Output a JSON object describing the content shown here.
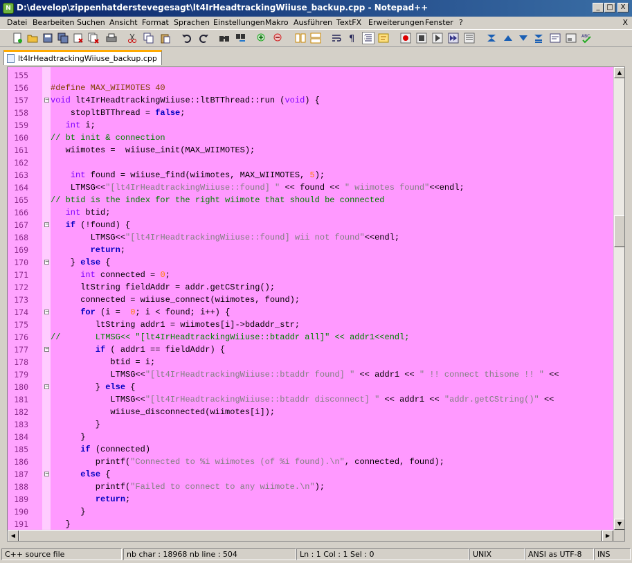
{
  "window": {
    "title": "D:\\develop\\zippenhatderstevegesagt\\lt4IrHeadtrackingWiiuse_backup.cpp - Notepad++",
    "app_icon": "notepad-plus-plus-icon",
    "minimize": "_",
    "maximize": "□",
    "close": "X"
  },
  "menu": {
    "items": [
      "Datei",
      "Bearbeiten",
      "Suchen",
      "Ansicht",
      "Format",
      "Sprachen",
      "Einstellungen",
      "Makro",
      "Ausführen",
      "TextFX",
      "Erweiterungen",
      "Fenster",
      "?"
    ],
    "close_doc": "X"
  },
  "toolbar": {
    "icons": [
      "new-file-icon",
      "open-file-icon",
      "save-icon",
      "save-all-icon",
      "close-icon",
      "close-all-icon",
      "print-icon",
      "cut-icon",
      "copy-icon",
      "paste-icon",
      "undo-icon",
      "redo-icon",
      "find-icon",
      "replace-icon",
      "zoom-in-icon",
      "zoom-out-icon",
      "sync-vertical-icon",
      "sync-horizontal-icon",
      "word-wrap-icon",
      "show-all-chars-icon",
      "indent-guide-icon",
      "user-lang-icon",
      "record-macro-icon",
      "stop-macro-icon",
      "play-macro-icon",
      "run-macro-multiple-icon",
      "save-macro-icon",
      "fold-all-icon",
      "previous-icon",
      "next-icon",
      "doc-map-icon",
      "function-list-icon",
      "panel-icon",
      "spellcheck-icon"
    ]
  },
  "tab": {
    "label": "lt4IrHeadtrackingWiiuse_backup.cpp"
  },
  "editor": {
    "lines": [
      {
        "n": "155",
        "fold": "",
        "segs": []
      },
      {
        "n": "156",
        "fold": "",
        "segs": [
          [
            "pp",
            "#define MAX_WIIMOTES 40"
          ]
        ]
      },
      {
        "n": "157",
        "fold": "-",
        "segs": [
          [
            "ty",
            "void"
          ],
          [
            "",
            " lt4IrHeadtrackingWiiuse::ltBTThread::run ("
          ],
          [
            "ty",
            "void"
          ],
          [
            "",
            ") {"
          ]
        ]
      },
      {
        "n": "158",
        "fold": "",
        "segs": [
          [
            "",
            "    stopltBTThread = "
          ],
          [
            "kw",
            "false"
          ],
          [
            "",
            ";"
          ]
        ]
      },
      {
        "n": "159",
        "fold": "",
        "segs": [
          [
            "",
            "   "
          ],
          [
            "ty",
            "int"
          ],
          [
            "",
            " i;"
          ]
        ]
      },
      {
        "n": "160",
        "fold": "",
        "segs": [
          [
            "cm",
            "// bt init & connection"
          ]
        ]
      },
      {
        "n": "161",
        "fold": "",
        "segs": [
          [
            "",
            "   wiimotes =  wiiuse_init(MAX_WIIMOTES);"
          ]
        ]
      },
      {
        "n": "162",
        "fold": "",
        "segs": []
      },
      {
        "n": "163",
        "fold": "",
        "segs": [
          [
            "",
            "    "
          ],
          [
            "ty",
            "int"
          ],
          [
            "",
            " found = wiiuse_find(wiimotes, MAX_WIIMOTES, "
          ],
          [
            "num",
            "5"
          ],
          [
            "",
            ");"
          ]
        ]
      },
      {
        "n": "164",
        "fold": "",
        "segs": [
          [
            "",
            "    LTMSG<<"
          ],
          [
            "str",
            "\"[lt4IrHeadtrackingWiiuse::found] \""
          ],
          [
            "",
            " << found << "
          ],
          [
            "str",
            "\" wiimotes found\""
          ],
          [
            "",
            "<<endl;"
          ]
        ]
      },
      {
        "n": "165",
        "fold": "",
        "segs": [
          [
            "cm",
            "// btid is the index for the right wiimote that should be connected"
          ]
        ]
      },
      {
        "n": "166",
        "fold": "",
        "segs": [
          [
            "",
            "   "
          ],
          [
            "ty",
            "int"
          ],
          [
            "",
            " btid;"
          ]
        ]
      },
      {
        "n": "167",
        "fold": "-",
        "segs": [
          [
            "",
            "   "
          ],
          [
            "kw",
            "if"
          ],
          [
            "",
            " (!found) {"
          ]
        ]
      },
      {
        "n": "168",
        "fold": "",
        "segs": [
          [
            "",
            "        LTMSG<<"
          ],
          [
            "str",
            "\"[lt4IrHeadtrackingWiiuse::found] wii not found\""
          ],
          [
            "",
            "<<endl;"
          ]
        ]
      },
      {
        "n": "169",
        "fold": "",
        "segs": [
          [
            "",
            "        "
          ],
          [
            "kw",
            "return"
          ],
          [
            "",
            ";"
          ]
        ]
      },
      {
        "n": "170",
        "fold": "-",
        "segs": [
          [
            "",
            "    } "
          ],
          [
            "kw",
            "else"
          ],
          [
            "",
            " {"
          ]
        ]
      },
      {
        "n": "171",
        "fold": "",
        "segs": [
          [
            "",
            "      "
          ],
          [
            "ty",
            "int"
          ],
          [
            "",
            " connected = "
          ],
          [
            "num",
            "0"
          ],
          [
            "",
            ";"
          ]
        ]
      },
      {
        "n": "172",
        "fold": "",
        "segs": [
          [
            "",
            "      ltString fieldAddr = addr.getCString();"
          ]
        ]
      },
      {
        "n": "173",
        "fold": "",
        "segs": [
          [
            "",
            "      connected = wiiuse_connect(wiimotes, found);"
          ]
        ]
      },
      {
        "n": "174",
        "fold": "-",
        "segs": [
          [
            "",
            "      "
          ],
          [
            "kw",
            "for"
          ],
          [
            "",
            " (i =  "
          ],
          [
            "num",
            "0"
          ],
          [
            "",
            "; i < found; i++) {"
          ]
        ]
      },
      {
        "n": "175",
        "fold": "",
        "segs": [
          [
            "",
            "         ltString addr1 = wiimotes[i]->bdaddr_str;"
          ]
        ]
      },
      {
        "n": "176",
        "fold": "",
        "segs": [
          [
            "cm",
            "//       LTMSG<< \"[lt4IrHeadtrackingWiiuse::btaddr all]\" << addr1<<endl;"
          ]
        ]
      },
      {
        "n": "177",
        "fold": "-",
        "segs": [
          [
            "",
            "         "
          ],
          [
            "kw",
            "if"
          ],
          [
            "",
            " ( addr1 == fieldAddr) {"
          ]
        ]
      },
      {
        "n": "178",
        "fold": "",
        "segs": [
          [
            "",
            "            btid = i;"
          ]
        ]
      },
      {
        "n": "179",
        "fold": "",
        "segs": [
          [
            "",
            "            LTMSG<<"
          ],
          [
            "str",
            "\"[lt4IrHeadtrackingWiiuse::btaddr found] \""
          ],
          [
            "",
            " << addr1 << "
          ],
          [
            "str",
            "\" !! connect thisone !! \""
          ],
          [
            "",
            " <<"
          ]
        ]
      },
      {
        "n": "180",
        "fold": "-",
        "segs": [
          [
            "",
            "         } "
          ],
          [
            "kw",
            "else"
          ],
          [
            "",
            " {"
          ]
        ]
      },
      {
        "n": "181",
        "fold": "",
        "segs": [
          [
            "",
            "            LTMSG<<"
          ],
          [
            "str",
            "\"[lt4IrHeadtrackingWiiuse::btaddr disconnect] \""
          ],
          [
            "",
            " << addr1 << "
          ],
          [
            "str",
            "\"addr.getCString()\""
          ],
          [
            "",
            " <<"
          ]
        ]
      },
      {
        "n": "182",
        "fold": "",
        "segs": [
          [
            "",
            "            wiiuse_disconnected(wiimotes[i]);"
          ]
        ]
      },
      {
        "n": "183",
        "fold": "",
        "segs": [
          [
            "",
            "         }"
          ]
        ]
      },
      {
        "n": "184",
        "fold": "",
        "segs": [
          [
            "",
            "      }"
          ]
        ]
      },
      {
        "n": "185",
        "fold": "",
        "segs": [
          [
            "",
            "      "
          ],
          [
            "kw",
            "if"
          ],
          [
            "",
            " (connected)"
          ]
        ]
      },
      {
        "n": "186",
        "fold": "",
        "segs": [
          [
            "",
            "         printf("
          ],
          [
            "str",
            "\"Connected to %i wiimotes (of %i found).\\n\""
          ],
          [
            "",
            ", connected, found);"
          ]
        ]
      },
      {
        "n": "187",
        "fold": "-",
        "segs": [
          [
            "",
            "      "
          ],
          [
            "kw",
            "else"
          ],
          [
            "",
            " {"
          ]
        ]
      },
      {
        "n": "188",
        "fold": "",
        "segs": [
          [
            "",
            "         printf("
          ],
          [
            "str",
            "\"Failed to connect to any wiimote.\\n\""
          ],
          [
            "",
            ");"
          ]
        ]
      },
      {
        "n": "189",
        "fold": "",
        "segs": [
          [
            "",
            "         "
          ],
          [
            "kw",
            "return"
          ],
          [
            "",
            ";"
          ]
        ]
      },
      {
        "n": "190",
        "fold": "",
        "segs": [
          [
            "",
            "      }"
          ]
        ]
      },
      {
        "n": "191",
        "fold": "",
        "segs": [
          [
            "",
            "   }"
          ]
        ]
      }
    ]
  },
  "statusbar": {
    "file_type": "C++ source file",
    "counts": "nb char : 18968    nb line : 504",
    "position": "Ln : 1    Col : 1    Sel : 0",
    "eol": "UNIX",
    "encoding": "ANSI as UTF-8",
    "mode": "INS"
  }
}
